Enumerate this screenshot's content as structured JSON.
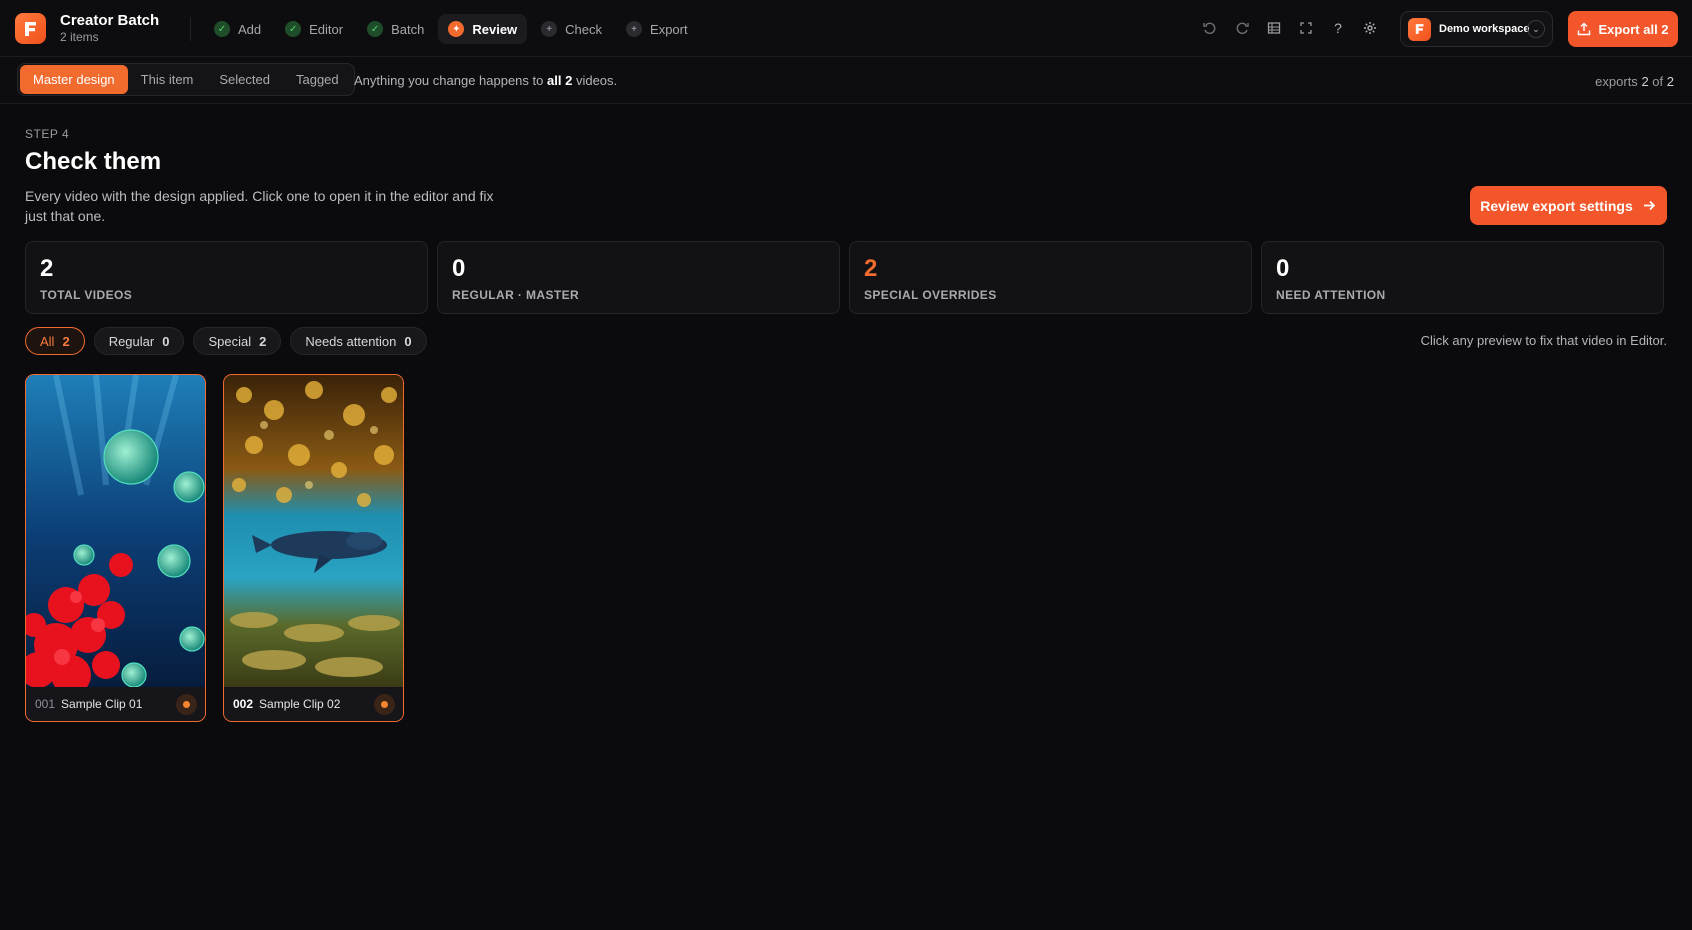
{
  "app": {
    "title": "Creator Batch",
    "subtitle": "2 items"
  },
  "steps": [
    {
      "label": "Add",
      "state": "done"
    },
    {
      "label": "Editor",
      "state": "done"
    },
    {
      "label": "Batch",
      "state": "done"
    },
    {
      "label": "Review",
      "state": "current"
    },
    {
      "label": "Check",
      "state": "todo"
    },
    {
      "label": "Export",
      "state": "todo"
    }
  ],
  "toolbar": {
    "icons": [
      "undo-icon",
      "redo-icon",
      "layout-icon",
      "fullscreen-icon",
      "help-icon",
      "settings-icon"
    ],
    "help_glyph": "?"
  },
  "workspace": {
    "name": "Demo workspace"
  },
  "export_all": {
    "label": "Export all 2"
  },
  "scope": {
    "tabs": [
      "Master design",
      "This item",
      "Selected",
      "Tagged"
    ],
    "active": "Master design",
    "note_prefix": "Anything you change happens to",
    "note_all": "all",
    "note_count": "2",
    "note_suffix": "videos."
  },
  "exports_status": {
    "prefix": "exports",
    "done": "2",
    "of": "of",
    "total": "2"
  },
  "main": {
    "step_label": "STEP 4",
    "title": "Check them",
    "description": "Every video with the design applied. Click one to open it in the editor and fix just that one.",
    "review_button": "Review export settings"
  },
  "stats": [
    {
      "value": "2",
      "label": "TOTAL VIDEOS"
    },
    {
      "value": "0",
      "label": "REGULAR · MASTER"
    },
    {
      "value": "2",
      "label": "SPECIAL OVERRIDES"
    },
    {
      "value": "0",
      "label": "NEED ATTENTION"
    }
  ],
  "filters": [
    {
      "label": "All",
      "count": "2"
    },
    {
      "label": "Regular",
      "count": "0"
    },
    {
      "label": "Special",
      "count": "2"
    },
    {
      "label": "Needs attention",
      "count": "0"
    }
  ],
  "hint": "Click any preview to fix that video in Editor.",
  "clips": [
    {
      "num": "001",
      "name": "Sample Clip 01"
    },
    {
      "num": "002",
      "name": "Sample Clip 02"
    }
  ],
  "colors": {
    "accent": "#f26b2e",
    "button": "#f2562a",
    "background": "#0b0b0d",
    "done_check": "#54d36f"
  }
}
